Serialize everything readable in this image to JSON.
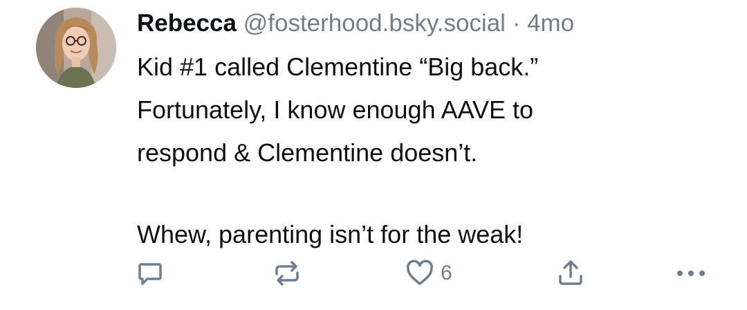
{
  "post": {
    "author_name": "Rebecca",
    "handle": "@fosterhood.bsky.social",
    "separator": "·",
    "timestamp": "4mo",
    "body": [
      "Kid #1 called Clementine “Big back.”",
      "Fortunately, I know enough AAVE to",
      "respond & Clementine doesn’t.",
      "Whew, parenting isn’t for the weak!"
    ]
  },
  "actions": {
    "reply_icon": "reply-icon",
    "repost_icon": "repost-icon",
    "like_icon": "heart-icon",
    "like_count": "6",
    "share_icon": "share-icon",
    "more_icon": "more-icon"
  },
  "colors": {
    "text": "#0b0f14",
    "muted": "#6f7e8c",
    "background": "#ffffff"
  }
}
